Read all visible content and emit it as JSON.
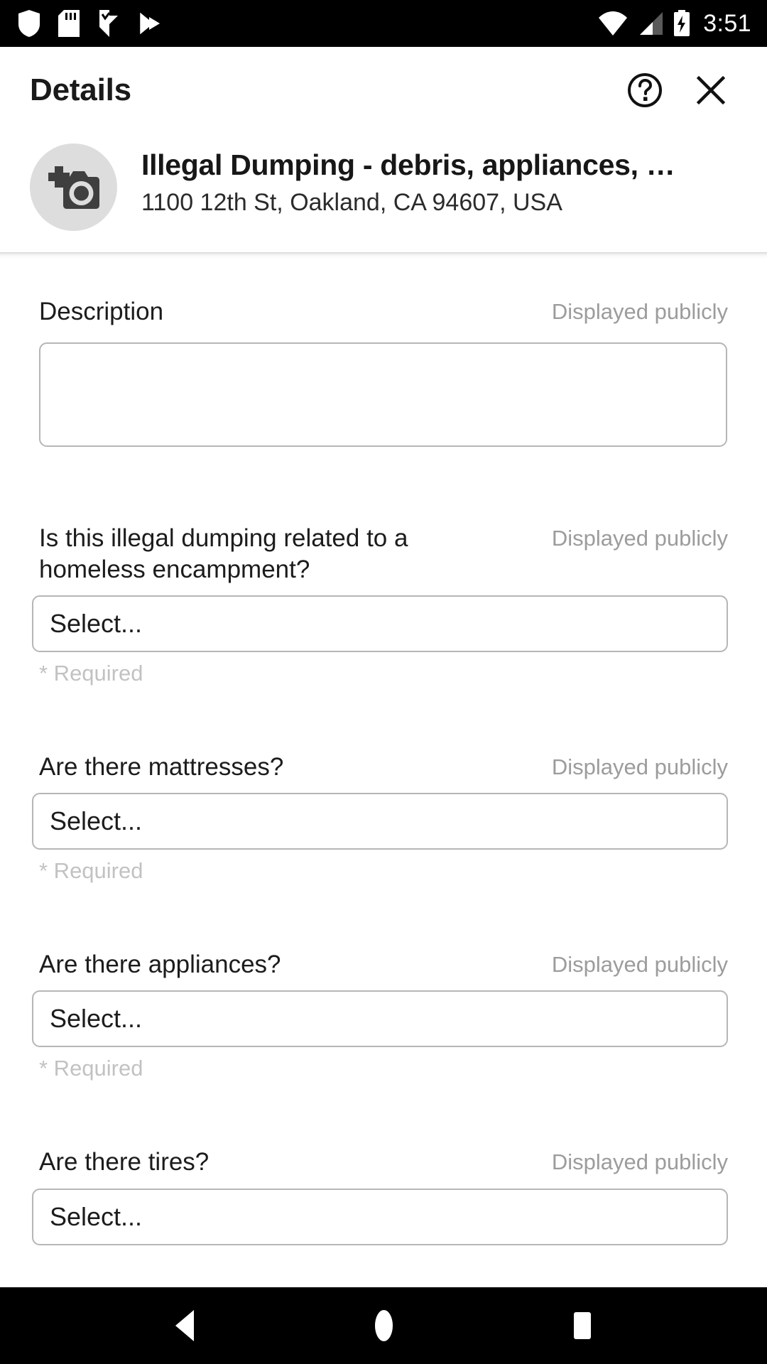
{
  "status_bar": {
    "time": "3:51",
    "left_icons": [
      "shield-icon",
      "sd-card-icon",
      "vpn-key-icon",
      "play-store-icon"
    ],
    "right_icons": [
      "wifi-icon",
      "cell-signal-icon",
      "battery-charging-icon"
    ],
    "background": "#000000",
    "foreground": "#ffffff"
  },
  "topbar": {
    "title": "Details",
    "help_icon": "help-circle-icon",
    "close_icon": "close-icon"
  },
  "report_header": {
    "avatar_icon": "add-a-photo-icon",
    "title": "Illegal Dumping - debris, appliances, …",
    "address": "1100 12th St, Oakland, CA 94607, USA"
  },
  "form": {
    "public_label": "Displayed publicly",
    "required_label": "* Required",
    "select_placeholder": "Select...",
    "fields": [
      {
        "label": "Description",
        "type": "textarea",
        "value": "",
        "public": "Displayed publicly",
        "required_note": ""
      },
      {
        "label": "Is this illegal dumping related to a homeless encampment?",
        "type": "select",
        "value": "Select...",
        "public": "Displayed publicly",
        "required_note": "* Required"
      },
      {
        "label": "Are there mattresses?",
        "type": "select",
        "value": "Select...",
        "public": "Displayed publicly",
        "required_note": "* Required"
      },
      {
        "label": "Are there appliances?",
        "type": "select",
        "value": "Select...",
        "public": "Displayed publicly",
        "required_note": "* Required"
      },
      {
        "label": "Are there tires?",
        "type": "select",
        "value": "Select...",
        "public": "Displayed publicly",
        "required_note": ""
      }
    ]
  },
  "navbar": {
    "back_icon": "nav-back-icon",
    "home_icon": "nav-home-icon",
    "recents_icon": "nav-recents-icon"
  },
  "colors": {
    "border": "#b6b6b6",
    "muted_text": "#9c9c9c",
    "required_text": "#c2c2c2",
    "avatar_bg": "#dddddd",
    "icon_dark": "#3f3f3f"
  }
}
